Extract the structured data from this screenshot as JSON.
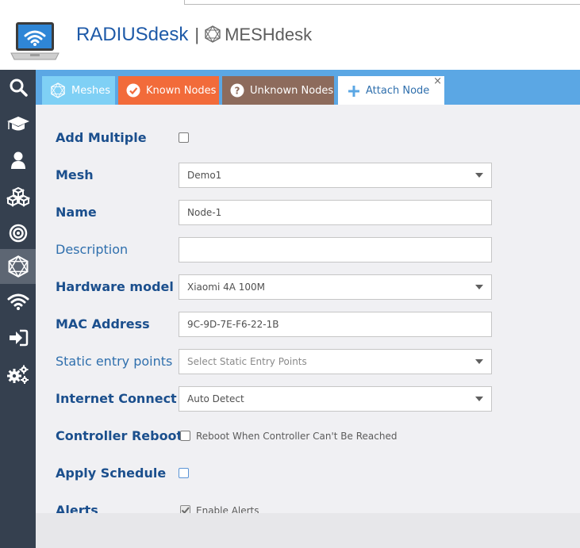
{
  "app": {
    "title": "RADIUSdesk",
    "separator": "|",
    "subtitle": "MESHdesk"
  },
  "icons": {
    "logo": "laptop-wifi-icon",
    "mesh_logo": "mesh-hexagon-icon"
  },
  "nav": {
    "items": [
      {
        "name": "search",
        "icon": "search-icon"
      },
      {
        "name": "graduation",
        "icon": "graduation-cap-icon"
      },
      {
        "name": "user",
        "icon": "user-icon"
      },
      {
        "name": "cubes",
        "icon": "cubes-icon"
      },
      {
        "name": "target",
        "icon": "target-icon"
      },
      {
        "name": "mesh",
        "icon": "mesh-hexagon-icon",
        "active": true
      },
      {
        "name": "wifi",
        "icon": "wifi-icon"
      },
      {
        "name": "sign-in",
        "icon": "sign-in-icon"
      },
      {
        "name": "settings",
        "icon": "cogs-icon"
      }
    ]
  },
  "tabs": {
    "meshes": "Meshes",
    "known_nodes": "Known Nodes",
    "unknown_nodes": "Unknown Nodes",
    "attach_node": "Attach Node",
    "close": "×"
  },
  "colors": {
    "tabbar": "#5ba7e4",
    "meshes_tab": "#7fd0f5",
    "known_tab": "#f26b3a",
    "unknown_tab": "#8d6b5c",
    "nav_bg": "#35404f",
    "label_blue": "#1b4f8d"
  },
  "form": {
    "add_multiple": {
      "label": "Add Multiple",
      "checked": false
    },
    "mesh": {
      "label": "Mesh",
      "value": "Demo1"
    },
    "name": {
      "label": "Name",
      "value": "Node-1"
    },
    "description": {
      "label": "Description",
      "value": ""
    },
    "hardware_model": {
      "label": "Hardware model",
      "value": "Xiaomi 4A 100M"
    },
    "mac_address": {
      "label": "MAC Address",
      "value": "9C-9D-7E-F6-22-1B"
    },
    "static_entry_points": {
      "label": "Static entry points",
      "placeholder": "Select Static Entry Points"
    },
    "internet_connect": {
      "label": "Internet Connect",
      "value": "Auto Detect"
    },
    "controller_reboot": {
      "label": "Controller Reboot",
      "checkbox_label": "Reboot When Controller Can't Be Reached",
      "checked": false
    },
    "apply_schedule": {
      "label": "Apply Schedule",
      "checked": false
    },
    "alerts": {
      "label": "Alerts",
      "checkbox_label": "Enable Alerts",
      "checked": true
    }
  }
}
